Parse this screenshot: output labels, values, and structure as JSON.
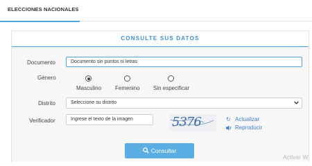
{
  "tabs": {
    "active_label": "ELECCIONES NACIONALES"
  },
  "panel": {
    "title": "CONSULTE SUS DATOS"
  },
  "form": {
    "documento": {
      "label": "Documento",
      "value": "Documento sin puntos ni letras"
    },
    "genero": {
      "label": "Género",
      "options": [
        {
          "label": "Masculino",
          "checked": true
        },
        {
          "label": "Femenino",
          "checked": false
        },
        {
          "label": "Sin especificar",
          "checked": false
        }
      ]
    },
    "distrito": {
      "label": "Distrito",
      "value": "Seleccione su distrito"
    },
    "verificador": {
      "label": "Verificador",
      "placeholder": "Ingrese el texto de la imagen"
    }
  },
  "captcha": {
    "text": "5376",
    "refresh_label": "Actualizar",
    "play_label": "Reproducir",
    "refresh_icon": "refresh-icon",
    "play_icon": "speaker-icon"
  },
  "submit": {
    "label": "Consultar",
    "icon": "search-icon"
  },
  "watermark": "Activar W",
  "colors": {
    "accent": "#4aa3df",
    "button": "#5aaee3",
    "link": "#3a7ec7",
    "title": "#3a8fd0"
  }
}
